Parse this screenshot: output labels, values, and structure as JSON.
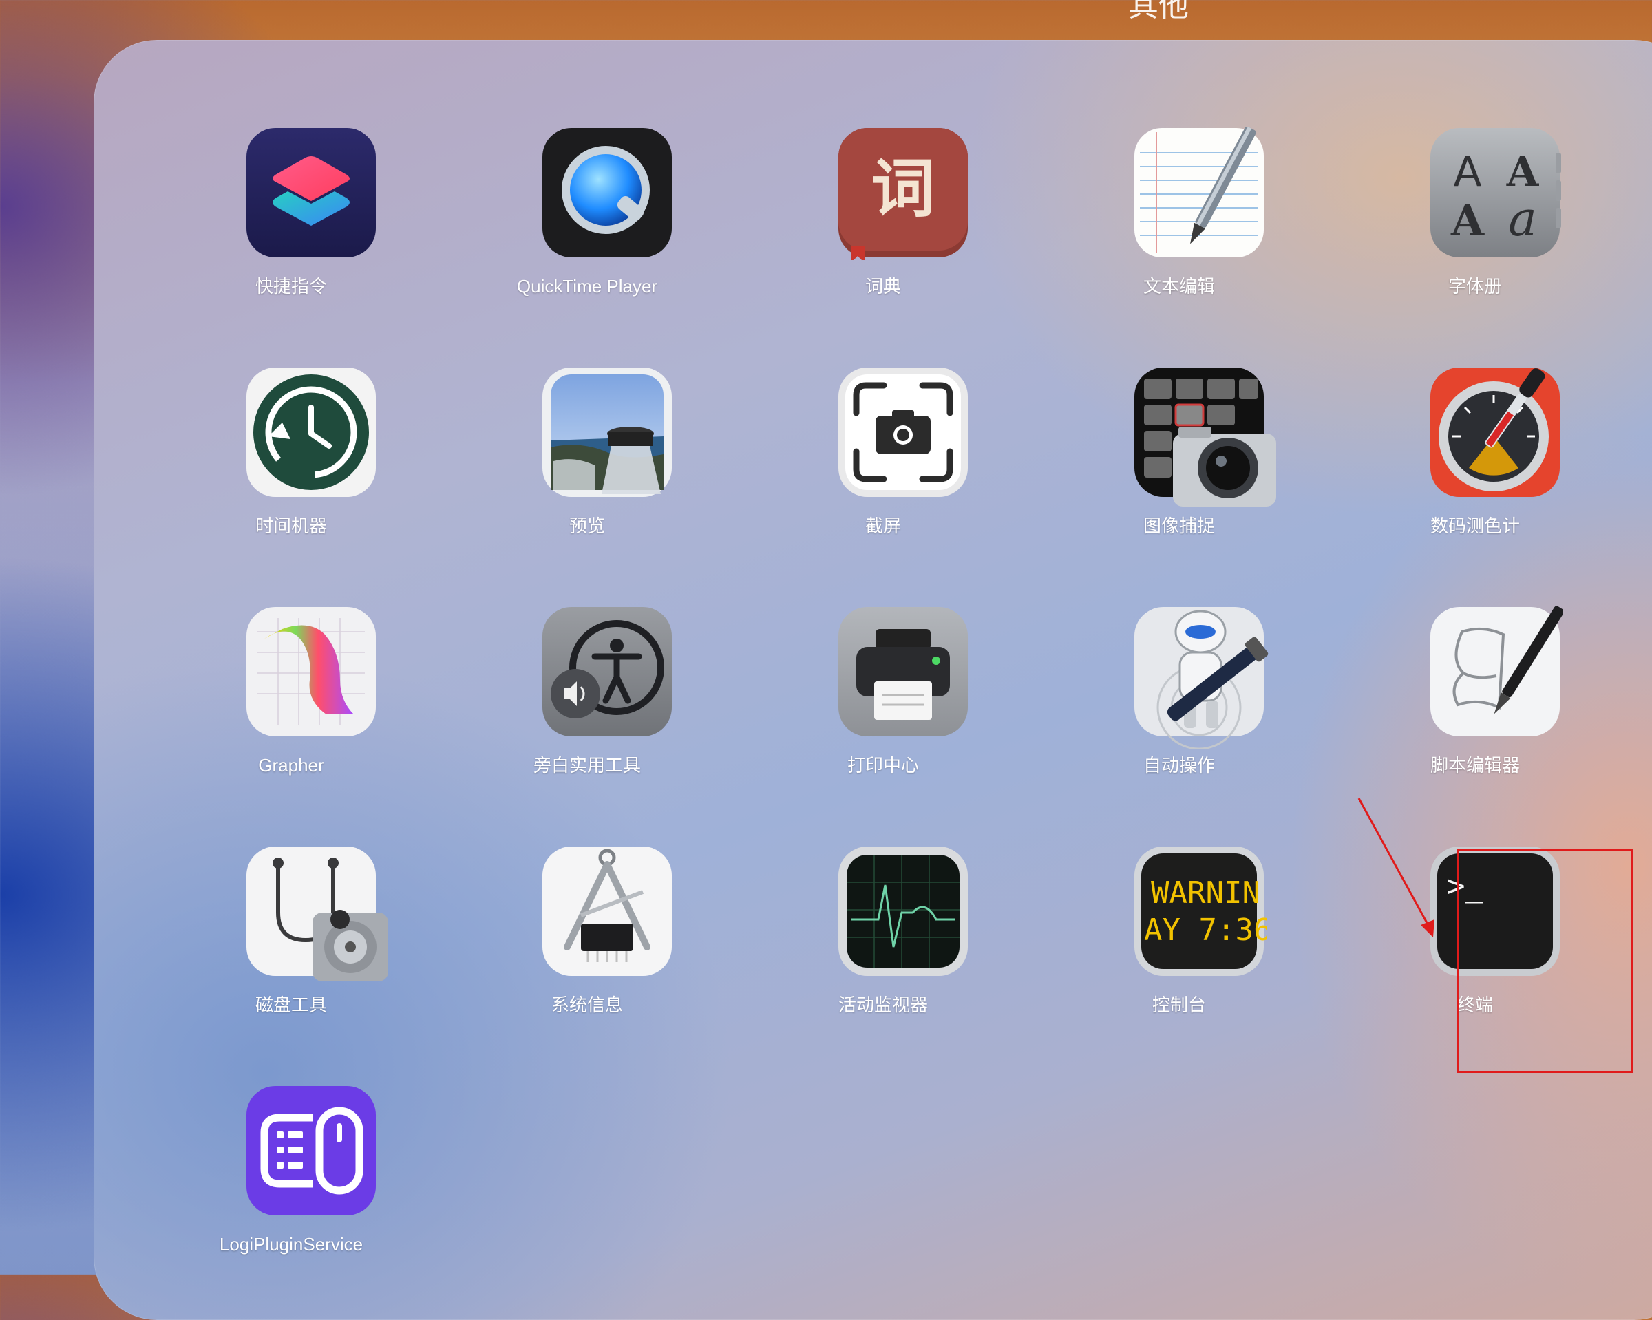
{
  "folder": {
    "title": "其他"
  },
  "apps": [
    {
      "label": "快捷指令",
      "icon": "shortcuts-icon"
    },
    {
      "label": "QuickTime Player",
      "icon": "quicktime-icon"
    },
    {
      "label": "词典",
      "icon": "dictionary-icon",
      "glyph": "词"
    },
    {
      "label": "文本编辑",
      "icon": "textedit-icon"
    },
    {
      "label": "字体册",
      "icon": "fontbook-icon",
      "glyphs": [
        "A",
        "A",
        "A",
        "a"
      ]
    },
    {
      "label": "时间机器",
      "icon": "time-machine-icon"
    },
    {
      "label": "预览",
      "icon": "preview-icon"
    },
    {
      "label": "截屏",
      "icon": "screenshot-icon"
    },
    {
      "label": "图像捕捉",
      "icon": "image-capture-icon"
    },
    {
      "label": "数码测色计",
      "icon": "color-meter-icon"
    },
    {
      "label": "Grapher",
      "icon": "grapher-icon"
    },
    {
      "label": "旁白实用工具",
      "icon": "voiceover-utility-icon"
    },
    {
      "label": "打印中心",
      "icon": "print-center-icon"
    },
    {
      "label": "自动操作",
      "icon": "automator-icon"
    },
    {
      "label": "脚本编辑器",
      "icon": "script-editor-icon"
    },
    {
      "label": "磁盘工具",
      "icon": "disk-utility-icon"
    },
    {
      "label": "系统信息",
      "icon": "system-information-icon"
    },
    {
      "label": "活动监视器",
      "icon": "activity-monitor-icon"
    },
    {
      "label": "控制台",
      "icon": "console-icon",
      "lines": [
        "WARNIN",
        "AY 7:36"
      ]
    },
    {
      "label": "终端",
      "icon": "terminal-icon",
      "prompt": ">_"
    },
    {
      "label": "LogiPluginService",
      "icon": "logi-plugin-icon"
    }
  ],
  "annotation": {
    "highlighted_app": "终端",
    "color": "#e01b1b"
  }
}
